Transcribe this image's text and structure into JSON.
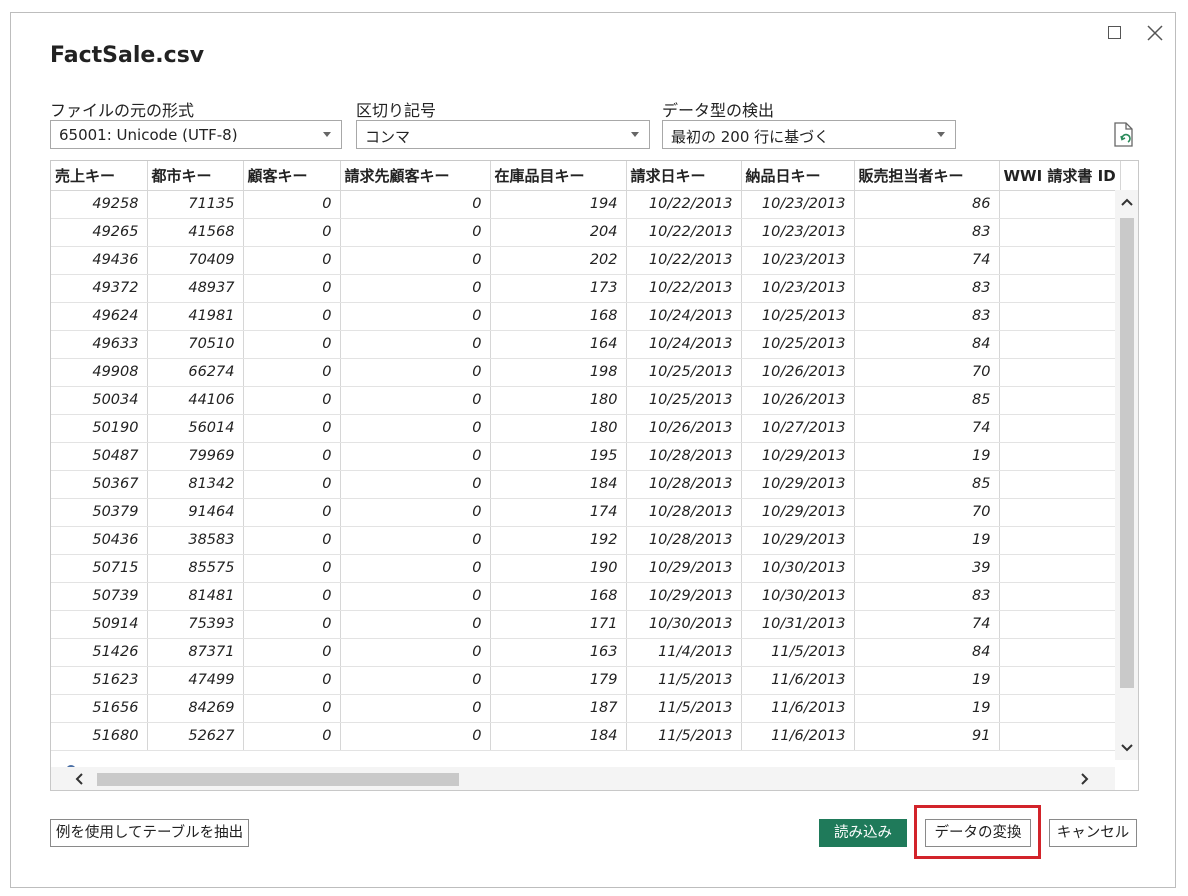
{
  "dialog": {
    "title": "FactSale.csv"
  },
  "options": {
    "file_origin": {
      "label": "ファイルの元の形式",
      "value": "65001: Unicode (UTF-8)"
    },
    "delimiter": {
      "label": "区切り記号",
      "value": "コンマ"
    },
    "type_detection": {
      "label": "データ型の検出",
      "value": "最初の 200 行に基づく"
    }
  },
  "grid": {
    "columns": [
      "売上キー",
      "都市キー",
      "顧客キー",
      "請求先顧客キー",
      "在庫品目キー",
      "請求日キー",
      "納品日キー",
      "販売担当者キー",
      "WWI 請求書 ID"
    ],
    "rows": [
      [
        "49258",
        "71135",
        "0",
        "0",
        "194",
        "10/22/2013",
        "10/23/2013",
        "86",
        ""
      ],
      [
        "49265",
        "41568",
        "0",
        "0",
        "204",
        "10/22/2013",
        "10/23/2013",
        "83",
        ""
      ],
      [
        "49436",
        "70409",
        "0",
        "0",
        "202",
        "10/22/2013",
        "10/23/2013",
        "74",
        ""
      ],
      [
        "49372",
        "48937",
        "0",
        "0",
        "173",
        "10/22/2013",
        "10/23/2013",
        "83",
        ""
      ],
      [
        "49624",
        "41981",
        "0",
        "0",
        "168",
        "10/24/2013",
        "10/25/2013",
        "83",
        ""
      ],
      [
        "49633",
        "70510",
        "0",
        "0",
        "164",
        "10/24/2013",
        "10/25/2013",
        "84",
        ""
      ],
      [
        "49908",
        "66274",
        "0",
        "0",
        "198",
        "10/25/2013",
        "10/26/2013",
        "70",
        ""
      ],
      [
        "50034",
        "44106",
        "0",
        "0",
        "180",
        "10/25/2013",
        "10/26/2013",
        "85",
        ""
      ],
      [
        "50190",
        "56014",
        "0",
        "0",
        "180",
        "10/26/2013",
        "10/27/2013",
        "74",
        ""
      ],
      [
        "50487",
        "79969",
        "0",
        "0",
        "195",
        "10/28/2013",
        "10/29/2013",
        "19",
        ""
      ],
      [
        "50367",
        "81342",
        "0",
        "0",
        "184",
        "10/28/2013",
        "10/29/2013",
        "85",
        ""
      ],
      [
        "50379",
        "91464",
        "0",
        "0",
        "174",
        "10/28/2013",
        "10/29/2013",
        "70",
        ""
      ],
      [
        "50436",
        "38583",
        "0",
        "0",
        "192",
        "10/28/2013",
        "10/29/2013",
        "19",
        ""
      ],
      [
        "50715",
        "85575",
        "0",
        "0",
        "190",
        "10/29/2013",
        "10/30/2013",
        "39",
        ""
      ],
      [
        "50739",
        "81481",
        "0",
        "0",
        "168",
        "10/29/2013",
        "10/30/2013",
        "83",
        ""
      ],
      [
        "50914",
        "75393",
        "0",
        "0",
        "171",
        "10/30/2013",
        "10/31/2013",
        "74",
        ""
      ],
      [
        "51426",
        "87371",
        "0",
        "0",
        "163",
        "11/4/2013",
        "11/5/2013",
        "84",
        ""
      ],
      [
        "51623",
        "47499",
        "0",
        "0",
        "179",
        "11/5/2013",
        "11/6/2013",
        "19",
        ""
      ],
      [
        "51656",
        "84269",
        "0",
        "0",
        "187",
        "11/5/2013",
        "11/6/2013",
        "19",
        ""
      ],
      [
        "51680",
        "52627",
        "0",
        "0",
        "184",
        "11/5/2013",
        "11/6/2013",
        "91",
        ""
      ]
    ]
  },
  "buttons": {
    "extract_table": "例を使用してテーブルを抽出",
    "load": "読み込み",
    "transform": "データの変換",
    "cancel": "キャンセル"
  },
  "colors": {
    "load_button": "#1f7a5a",
    "highlight": "#d2232a"
  }
}
